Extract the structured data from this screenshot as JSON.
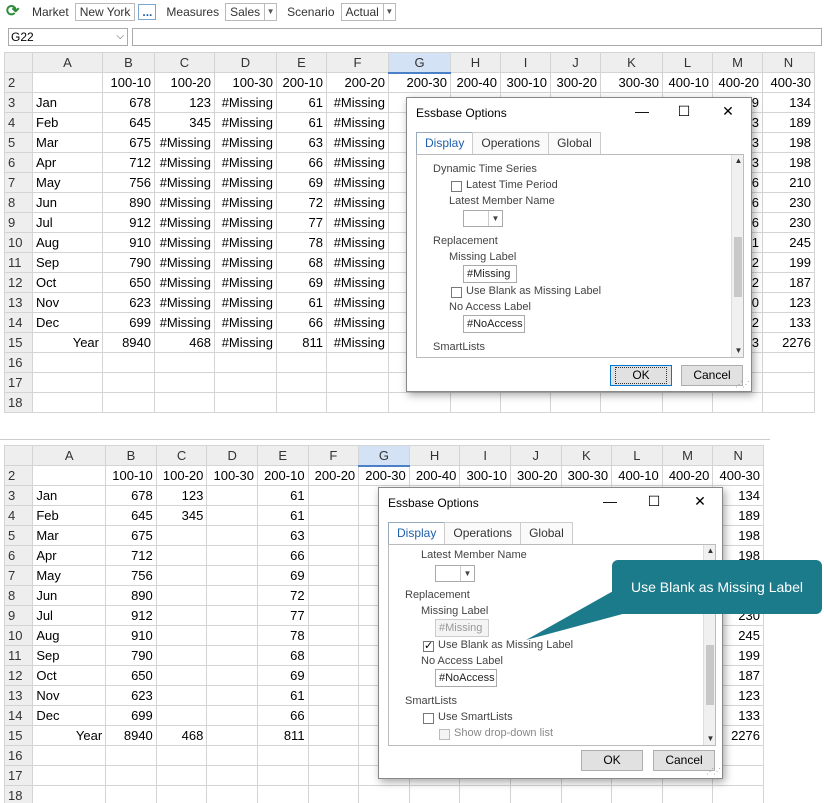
{
  "toolbar": {
    "market_label": "Market",
    "market_value": "New York",
    "more_label": "...",
    "measures_label": "Measures",
    "measures_value": "Sales",
    "scenario_label": "Scenario",
    "scenario_value": "Actual"
  },
  "cell_ref": "G22",
  "grid": {
    "columns": [
      "A",
      "B",
      "C",
      "D",
      "E",
      "F",
      "G",
      "H",
      "I",
      "J",
      "K",
      "L",
      "M",
      "N"
    ],
    "selected_column": "G",
    "row_numbers": [
      "2",
      "3",
      "4",
      "5",
      "6",
      "7",
      "8",
      "9",
      "10",
      "11",
      "12",
      "13",
      "14",
      "15",
      "16",
      "17",
      "18"
    ],
    "header_row": [
      "",
      "100-10",
      "100-20",
      "100-30",
      "200-10",
      "200-20",
      "200-30",
      "200-40",
      "300-10",
      "300-20",
      "300-30",
      "400-10",
      "400-20",
      "400-30"
    ],
    "rows_missing": [
      [
        "Jan",
        "678",
        "123",
        "#Missing",
        "61",
        "#Missing",
        "#M",
        "",
        "",
        "",
        "",
        "",
        "9",
        "134"
      ],
      [
        "Feb",
        "645",
        "345",
        "#Missing",
        "61",
        "#Missing",
        "#M",
        "",
        "",
        "",
        "",
        "",
        "3",
        "189"
      ],
      [
        "Mar",
        "675",
        "#Missing",
        "#Missing",
        "63",
        "#Missing",
        "#M",
        "",
        "",
        "",
        "",
        "",
        "3",
        "198"
      ],
      [
        "Apr",
        "712",
        "#Missing",
        "#Missing",
        "66",
        "#Missing",
        "#M",
        "",
        "",
        "",
        "",
        "",
        "3",
        "198"
      ],
      [
        "May",
        "756",
        "#Missing",
        "#Missing",
        "69",
        "#Missing",
        "#M",
        "",
        "",
        "",
        "",
        "",
        "6",
        "210"
      ],
      [
        "Jun",
        "890",
        "#Missing",
        "#Missing",
        "72",
        "#Missing",
        "#M",
        "",
        "",
        "",
        "",
        "",
        "6",
        "230"
      ],
      [
        "Jul",
        "912",
        "#Missing",
        "#Missing",
        "77",
        "#Missing",
        "#M",
        "",
        "",
        "",
        "",
        "",
        "6",
        "230"
      ],
      [
        "Aug",
        "910",
        "#Missing",
        "#Missing",
        "78",
        "#Missing",
        "#M",
        "",
        "",
        "",
        "",
        "",
        "1",
        "245"
      ],
      [
        "Sep",
        "790",
        "#Missing",
        "#Missing",
        "68",
        "#Missing",
        "#M",
        "",
        "",
        "",
        "",
        "",
        "2",
        "199"
      ],
      [
        "Oct",
        "650",
        "#Missing",
        "#Missing",
        "69",
        "#Missing",
        "#M",
        "",
        "",
        "",
        "",
        "",
        "2",
        "187"
      ],
      [
        "Nov",
        "623",
        "#Missing",
        "#Missing",
        "61",
        "#Missing",
        "#M",
        "",
        "",
        "",
        "",
        "",
        "0",
        "123"
      ],
      [
        "Dec",
        "699",
        "#Missing",
        "#Missing",
        "66",
        "#Missing",
        "#M",
        "",
        "",
        "",
        "",
        "",
        "2",
        "133"
      ],
      [
        "Year",
        "8940",
        "468",
        "#Missing",
        "811",
        "#Missing",
        "#M",
        "",
        "",
        "",
        "",
        "",
        "3",
        "2276"
      ]
    ],
    "rows_blank": [
      [
        "Jan",
        "678",
        "123",
        "",
        "61",
        "",
        "",
        "",
        "",
        "",
        "",
        "",
        "",
        "134"
      ],
      [
        "Feb",
        "645",
        "345",
        "",
        "61",
        "",
        "",
        "",
        "",
        "",
        "",
        "",
        "",
        "189"
      ],
      [
        "Mar",
        "675",
        "",
        "",
        "63",
        "",
        "",
        "",
        "",
        "",
        "",
        "",
        "",
        "198"
      ],
      [
        "Apr",
        "712",
        "",
        "",
        "66",
        "",
        "",
        "",
        "",
        "",
        "",
        "",
        "",
        "198"
      ],
      [
        "May",
        "756",
        "",
        "",
        "69",
        "",
        "",
        "",
        "",
        "",
        "",
        "",
        "",
        ""
      ],
      [
        "Jun",
        "890",
        "",
        "",
        "72",
        "",
        "",
        "",
        "",
        "",
        "",
        "",
        "",
        ""
      ],
      [
        "Jul",
        "912",
        "",
        "",
        "77",
        "",
        "",
        "",
        "",
        "",
        "",
        "",
        "",
        "230"
      ],
      [
        "Aug",
        "910",
        "",
        "",
        "78",
        "",
        "",
        "",
        "",
        "",
        "",
        "",
        "",
        "245"
      ],
      [
        "Sep",
        "790",
        "",
        "",
        "68",
        "",
        "",
        "",
        "",
        "",
        "",
        "",
        "",
        "199"
      ],
      [
        "Oct",
        "650",
        "",
        "",
        "69",
        "",
        "",
        "",
        "",
        "",
        "",
        "",
        "",
        "187"
      ],
      [
        "Nov",
        "623",
        "",
        "",
        "61",
        "",
        "",
        "",
        "",
        "",
        "",
        "",
        "",
        "123"
      ],
      [
        "Dec",
        "699",
        "",
        "",
        "66",
        "",
        "",
        "",
        "",
        "",
        "",
        "",
        "",
        "133"
      ],
      [
        "Year",
        "8940",
        "468",
        "",
        "811",
        "",
        "",
        "",
        "",
        "",
        "",
        "",
        "",
        "2276"
      ]
    ]
  },
  "dialog": {
    "title": "Essbase Options",
    "tabs": [
      "Display",
      "Operations",
      "Global"
    ],
    "active_tab": "Display",
    "dynamic_time_series": "Dynamic Time Series",
    "latest_time_period": "Latest Time Period",
    "latest_member_name": "Latest Member Name",
    "replacement": "Replacement",
    "missing_label": "Missing Label",
    "missing_value": "#Missing",
    "use_blank": "Use Blank as Missing Label",
    "no_access_label": "No Access Label",
    "no_access_value": "#NoAccess",
    "smartlists": "SmartLists",
    "use_smartlists": "Use SmartLists",
    "show_dropdown": "Show drop-down list",
    "ok": "OK",
    "cancel": "Cancel",
    "minimize_icon": "minimize-icon",
    "maximize_icon": "maximize-icon",
    "close_icon": "close-icon"
  },
  "callout": {
    "text": "Use Blank as Missing Label",
    "color": "#1b7b8a"
  },
  "colors": {
    "accent": "#1f5fa8",
    "selected_header": "#d3e3f5",
    "refresh_icon": "#2e8b3a"
  }
}
